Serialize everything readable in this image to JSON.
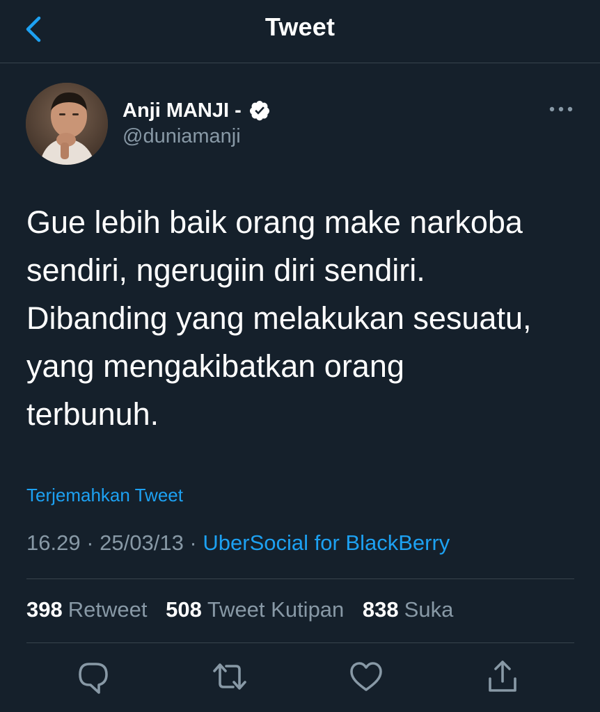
{
  "header": {
    "title": "Tweet",
    "back_icon": "chevron-left-icon"
  },
  "author": {
    "display_name": "Anji MANJI -",
    "username": "@duniamanji",
    "verified_icon": "verified-badge-icon"
  },
  "tweet": {
    "lines": [
      "Gue lebih baik orang make narkoba",
      "sendiri, ngerugiin diri sendiri.",
      "Dibanding yang melakukan sesuatu,",
      "yang mengakibatkan orang",
      "terbunuh."
    ],
    "translate_label": "Terjemahkan Tweet",
    "time": "16.29",
    "separator": " · ",
    "date": "25/03/13",
    "source": "UberSocial for BlackBerry"
  },
  "stats": {
    "retweets_count": "398",
    "retweets_label": "Retweet",
    "quotes_count": "508",
    "quotes_label": "Tweet Kutipan",
    "likes_count": "838",
    "likes_label": "Suka"
  },
  "actions": [
    "reply-icon",
    "retweet-icon",
    "like-icon",
    "share-icon"
  ],
  "colors": {
    "background": "#15202b",
    "accent": "#1da1f2",
    "secondary_text": "#8899a6",
    "divider": "#38444d"
  }
}
